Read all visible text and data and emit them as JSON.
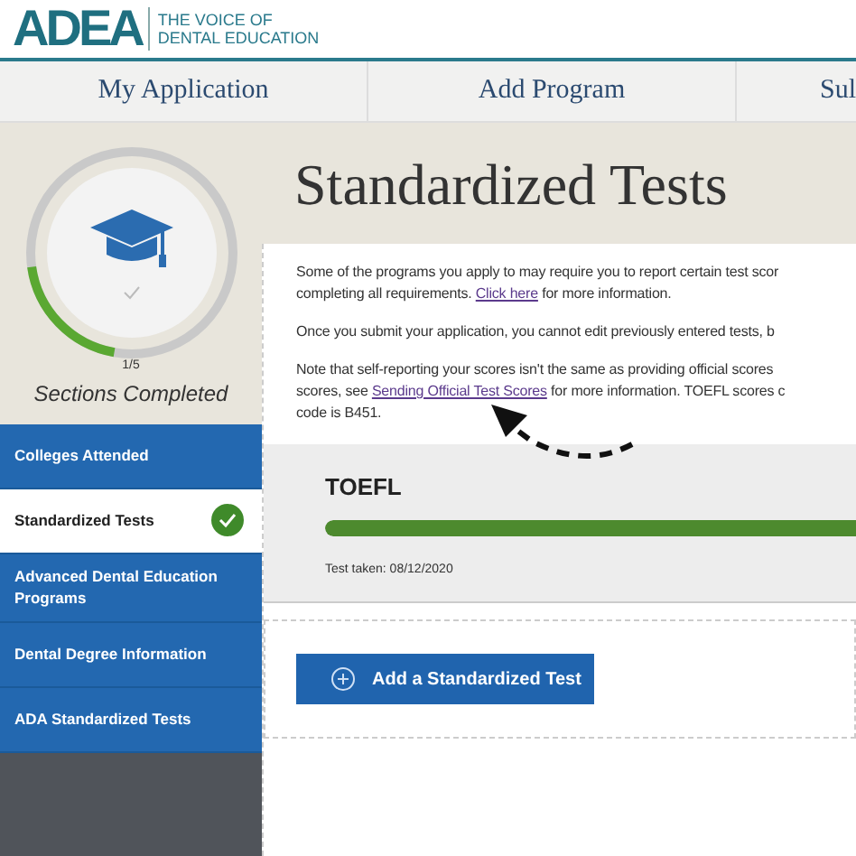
{
  "logo": {
    "mark": "ADEA",
    "tagline_lines": [
      "THE VOICE OF",
      "DENTAL EDUCATION"
    ]
  },
  "nav_tabs": [
    {
      "label": "My Application"
    },
    {
      "label": "Add Program"
    },
    {
      "label": "Sul"
    }
  ],
  "progress": {
    "level": 0.2,
    "count": "1/5",
    "label": "Sections Completed"
  },
  "sidebar": {
    "items": [
      {
        "label": "Colleges Attended",
        "selected": false,
        "completed": false
      },
      {
        "label": "Standardized Tests",
        "selected": true,
        "completed": true
      },
      {
        "label": "Advanced Dental Education Programs",
        "selected": false,
        "completed": false
      },
      {
        "label": "Dental Degree Information",
        "selected": false,
        "completed": false
      },
      {
        "label": "ADA Standardized Tests",
        "selected": false,
        "completed": false
      }
    ]
  },
  "page_title": "Standardized Tests",
  "paragraphs": [
    {
      "lines": [
        [
          {
            "text": "Some of the programs you apply to may require you to report certain test scor"
          }
        ],
        [
          {
            "text": "completing all requirements. "
          },
          {
            "link": "Click here"
          },
          {
            "text": " for more information."
          }
        ]
      ]
    },
    {
      "lines": [
        [
          {
            "text": "Once you submit your application, you cannot edit previously entered tests, b"
          }
        ]
      ]
    },
    {
      "lines": [
        [
          {
            "text": "Note that self-reporting your scores isn't the same as providing official scores"
          }
        ],
        [
          {
            "text": "scores, see "
          },
          {
            "link": "Sending Official Test Scores"
          },
          {
            "text": " for more information. TOEFL scores c"
          }
        ],
        [
          {
            "text": "code is B451."
          }
        ]
      ]
    }
  ],
  "test_card": {
    "name": "TOEFL",
    "level": 1,
    "taken": "Test taken: 08/12/2020"
  },
  "add_button": {
    "label": "Add a Standardized Test"
  }
}
